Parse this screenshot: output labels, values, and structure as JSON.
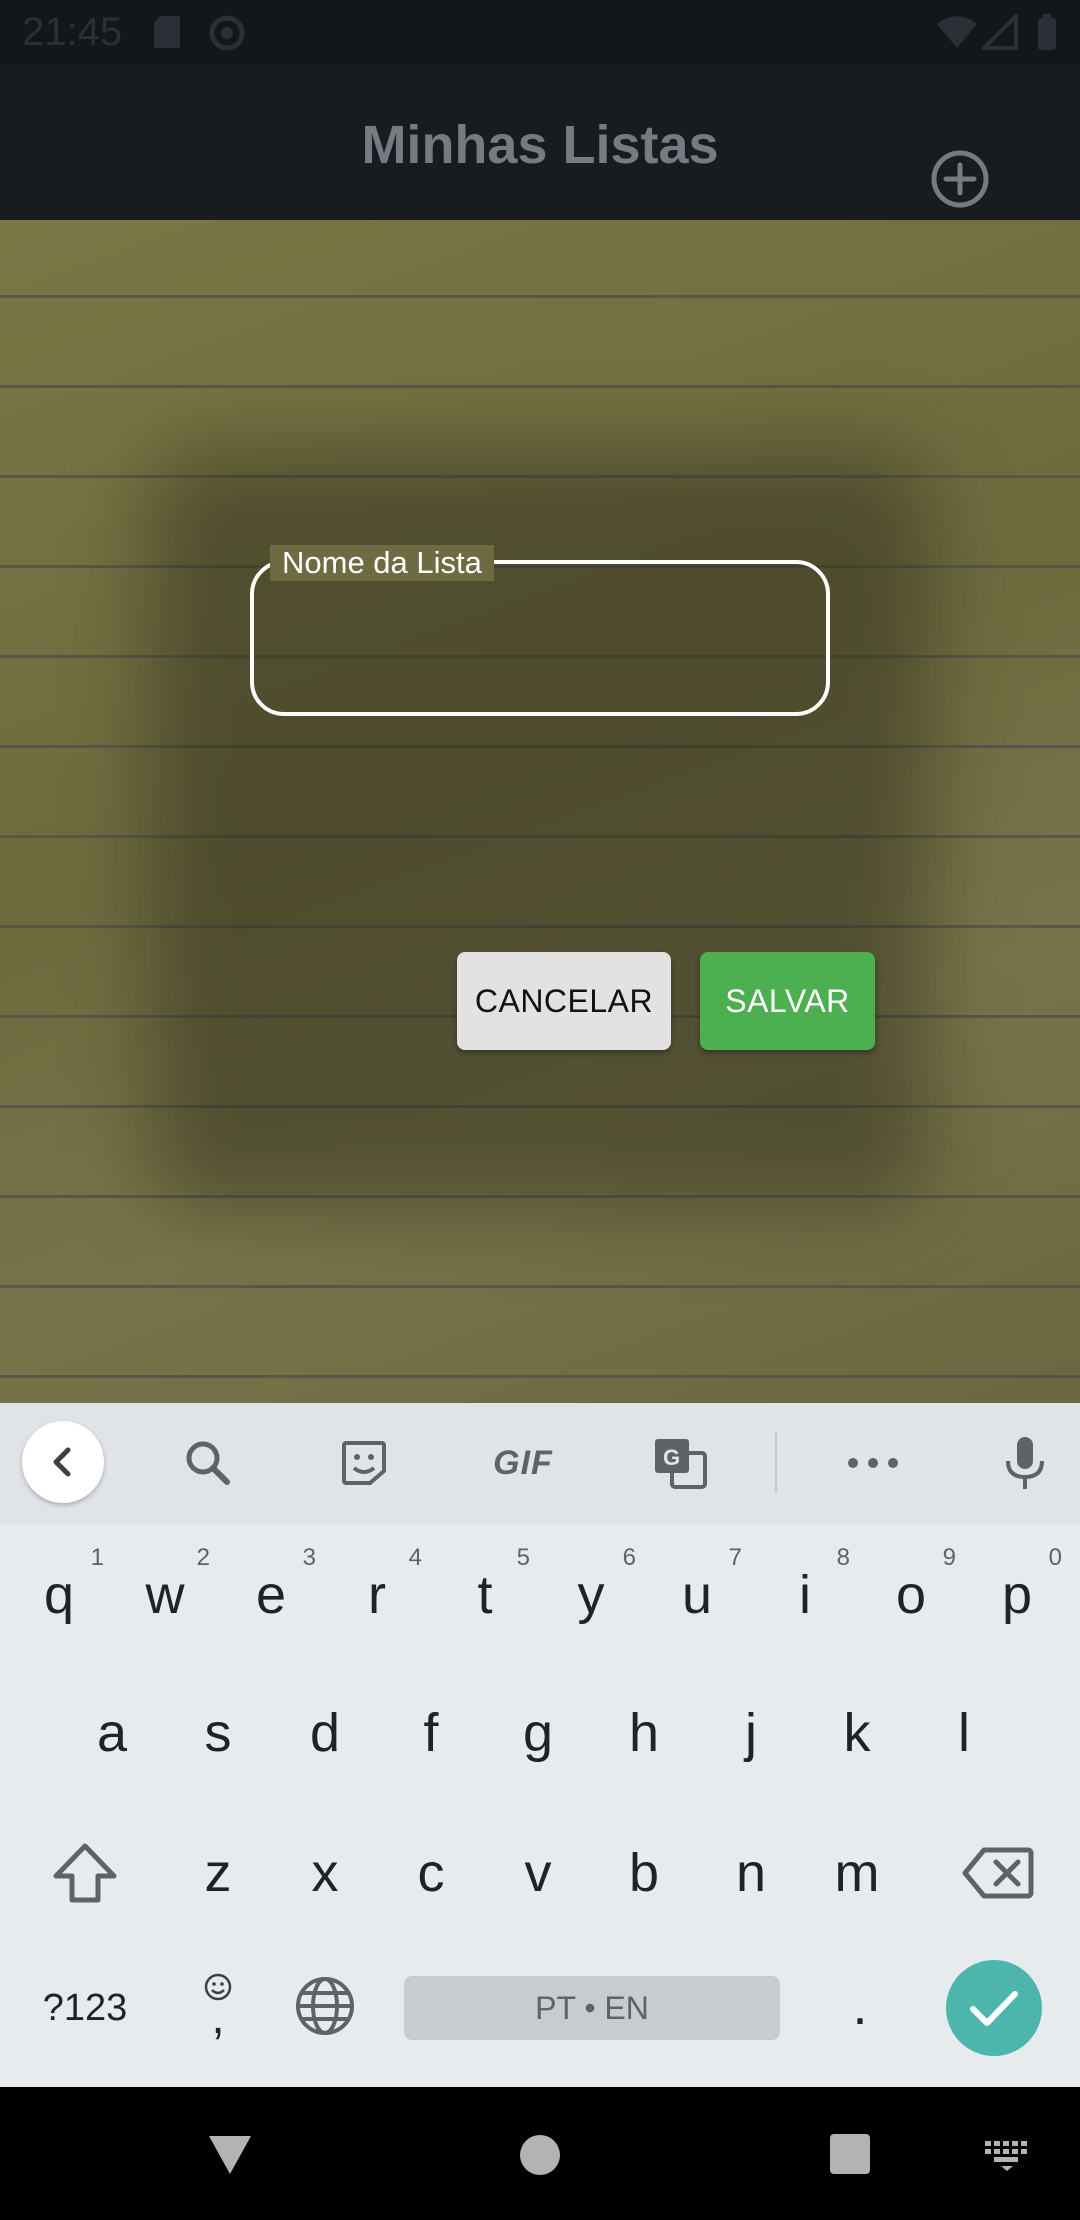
{
  "status_bar": {
    "time": "21:45"
  },
  "app_bar": {
    "title": "Minhas Listas",
    "add_icon": "add-circle-icon"
  },
  "dialog": {
    "field_label": "Nome da Lista",
    "field_value": "",
    "cancel_label": "CANCELAR",
    "save_label": "SALVAR",
    "save_color": "#4caf50"
  },
  "keyboard": {
    "toolbar": {
      "gif_label": "GIF"
    },
    "row1": [
      {
        "key": "q",
        "hint": "1"
      },
      {
        "key": "w",
        "hint": "2"
      },
      {
        "key": "e",
        "hint": "3"
      },
      {
        "key": "r",
        "hint": "4"
      },
      {
        "key": "t",
        "hint": "5"
      },
      {
        "key": "y",
        "hint": "6"
      },
      {
        "key": "u",
        "hint": "7"
      },
      {
        "key": "i",
        "hint": "8"
      },
      {
        "key": "o",
        "hint": "9"
      },
      {
        "key": "p",
        "hint": "0"
      }
    ],
    "row2": [
      "a",
      "s",
      "d",
      "f",
      "g",
      "h",
      "j",
      "k",
      "l"
    ],
    "row3": [
      "z",
      "x",
      "c",
      "v",
      "b",
      "n",
      "m"
    ],
    "symbols_label": "?123",
    "comma_label": ",",
    "space_label": "PT • EN",
    "period_label": ".",
    "enter_color": "#4db6ac"
  }
}
